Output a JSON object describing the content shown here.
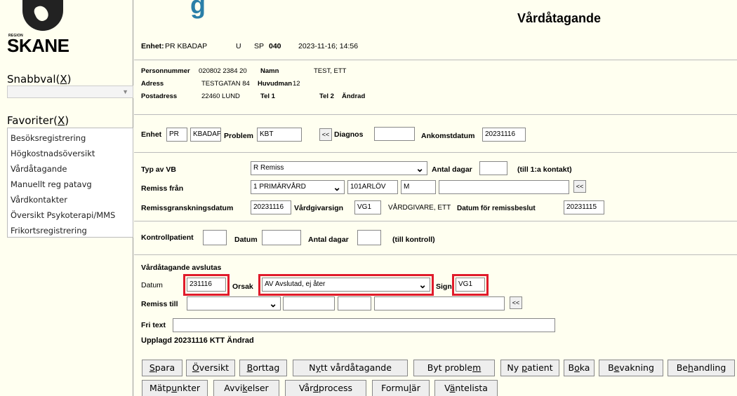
{
  "left": {
    "region_label": "REGION",
    "logo_text": "SKANE",
    "snabbval_label": "Snabbval(",
    "snabbval_key": "X",
    "snabbval_close": ")",
    "favoriter_label": "Favoriter(",
    "favoriter_key": "X",
    "favoriter_close": ")",
    "favorites": [
      "Besöksregistrering",
      "Högkostnadsöversikt",
      "Vårdåtagande",
      "Manuellt reg patavg",
      "Vårdkontakter",
      "Översikt Psykoterapi/MMS",
      "Frikortsregistrering"
    ]
  },
  "header": {
    "brand_tail": "g",
    "title": "Vårdåtagande",
    "enhet_label": "Enhet:",
    "enhet_value": "PR KBADAP",
    "u": "U",
    "sp": "SP",
    "sp_value": "040",
    "datetime": "2023-11-16; 14:56"
  },
  "patient": {
    "personnummer_label": "Personnummer",
    "personnummer": "020802 2384 20",
    "namn_label": "Namn",
    "namn": "TEST, ETT",
    "adress_label": "Adress",
    "adress": "TESTGATAN 84",
    "huvudman_label": "Huvudman",
    "huvudman": "12",
    "postadress_label": "Postadress",
    "postadress": "22460  LUND",
    "tel1_label": "Tel 1",
    "tel2_label": "Tel 2",
    "andrad": "Ändrad"
  },
  "section1": {
    "enhet_label": "Enhet",
    "enhet1": "PR",
    "enhet2": "KBADAP",
    "problem_label": "Problem",
    "problem": "KBT",
    "back": "<<",
    "diagnos_label": "Diagnos",
    "diagnos": "",
    "ankomstdatum_label": "Ankomstdatum",
    "ankomstdatum": "20231116"
  },
  "section2": {
    "typ_label": "Typ av VB",
    "typ_value": "R Remiss",
    "antal_dagar_label": "Antal dagar",
    "antal_dagar": "",
    "till_label": "(till 1:a kontakt)",
    "remiss_fran_label": "Remiss från",
    "remiss_fran": "1 PRIMÄRVÅRD",
    "remiss_fran_code": "101ARLÖV",
    "remiss_fran_m": "M",
    "back": "<<",
    "granskning_label": "Remissgranskningsdatum",
    "granskning": "20231116",
    "vardgivarsign_label": "Vårdgivarsign",
    "vardgivarsign": "VG1",
    "vardgivare_name": "VÅRDGIVARE, ETT",
    "beslut_label": "Datum för remissbeslut",
    "beslut": "20231115"
  },
  "section3": {
    "kontroll_label": "Kontrollpatient",
    "datum_label": "Datum",
    "antal_label": "Antal dagar",
    "till_label": "(till kontroll)"
  },
  "section4": {
    "avslutas_label": "Vårdåtagande avslutas",
    "datum_label": "Datum",
    "datum": "231116",
    "orsak_label": "Orsak",
    "orsak": "AV Avslutad, ej åter",
    "sign_label": "Sign",
    "sign": "VG1",
    "remiss_till_label": "Remiss till",
    "back": "<<",
    "fritext_label": "Fri text",
    "upplagd": "Upplagd 20231116  KTT   Ändrad"
  },
  "buttons": {
    "spara": [
      "",
      "S",
      "para"
    ],
    "oversikt": [
      "",
      "Ö",
      "versikt"
    ],
    "borttag": [
      "",
      "B",
      "orttag"
    ],
    "nytt": [
      "N",
      "y",
      "tt vårdåtagande"
    ],
    "byt": [
      "Byt proble",
      "m",
      ""
    ],
    "nypatient": [
      "Ny ",
      "p",
      "atient"
    ],
    "boka": [
      "B",
      "o",
      "ka"
    ],
    "bevakning": [
      "B",
      "e",
      "vakning"
    ],
    "behandling": [
      "Be",
      "h",
      "andling"
    ],
    "matpunkter": [
      "Mätp",
      "u",
      "nkter"
    ],
    "avvikelser": [
      "Avvi",
      "k",
      "elser"
    ],
    "vardprocess": [
      "Vår",
      "d",
      "process"
    ],
    "formular": [
      "Formu",
      "l",
      "är"
    ],
    "vantelista": [
      "V",
      "ä",
      "ntelista"
    ]
  },
  "colors": {
    "highlight": "#e01b2b",
    "brand": "#2a7fa8",
    "background": "#fffff0"
  }
}
